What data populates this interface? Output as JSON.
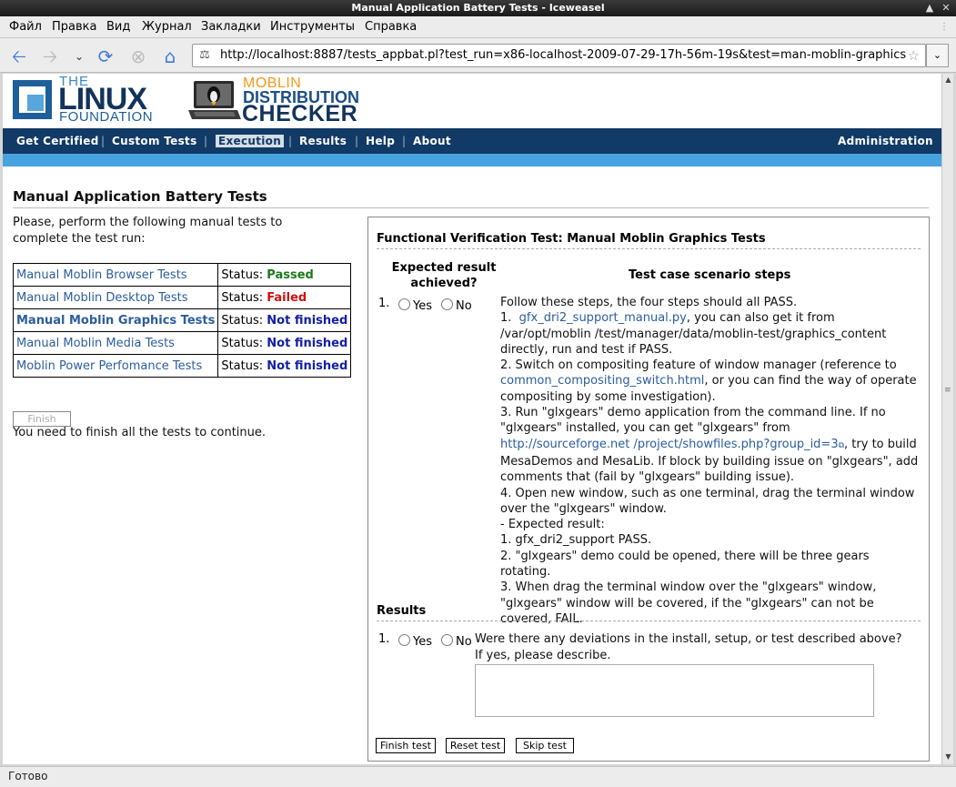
{
  "window": {
    "title": "Manual Application Battery Tests - Iceweasel",
    "controls": [
      "up-arrow",
      "close"
    ]
  },
  "menubar": [
    "Файл",
    "Правка",
    "Вид",
    "Журнал",
    "Закладки",
    "Инструменты",
    "Справка"
  ],
  "toolbar": {
    "url": "http://localhost:8887/tests_appbat.pl?test_run=x86-localhost-2009-07-29-17h-56m-19s&test=man-moblin-graphics",
    "buttons": [
      "back-icon",
      "forward-icon",
      "history-dropdown-icon",
      "reload-icon",
      "stop-icon",
      "home-icon"
    ],
    "accent": "#3f7ad6"
  },
  "header": {
    "lf_the": "THE",
    "lf_linux": "LINUX",
    "lf_foundation": "FOUNDATION",
    "mdc_moblin": "MOBLIN",
    "mdc_distribution": "DISTRIBUTION",
    "mdc_checker": "CHECKER"
  },
  "nav": {
    "get_certified": "Get Certified",
    "custom_tests": "Custom Tests",
    "execution": "Execution",
    "results": "Results",
    "help": "Help",
    "about": "About",
    "administration": "Administration",
    "sep": "|",
    "bg": "#113a66",
    "bar": "#48a4e0"
  },
  "page": {
    "title": "Manual Application Battery Tests",
    "intro": "Please, perform the following manual tests to complete the test run:",
    "tests": [
      {
        "name": "Manual Moblin Browser Tests",
        "status_label": "Status:",
        "status": "Passed"
      },
      {
        "name": "Manual Moblin Desktop Tests",
        "status_label": "Status:",
        "status": "Failed"
      },
      {
        "name": "Manual Moblin Graphics Tests",
        "status_label": "Status:",
        "status": "Not finished"
      },
      {
        "name": "Manual Moblin Media Tests",
        "status_label": "Status:",
        "status": "Not finished"
      },
      {
        "name": "Moblin Power Perfomance Tests",
        "status_label": "Status:",
        "status": "Not finished"
      }
    ],
    "finish_button": "Finish",
    "finish_note": "You need to finish all the tests to continue."
  },
  "panel": {
    "title": "Functional Verification Test: Manual Moblin Graphics Tests",
    "col_expected": "Expected result achieved?",
    "col_steps": "Test case scenario steps",
    "step_number": "1.",
    "yes": "Yes",
    "no": "No",
    "steps": {
      "intro": "Follow these steps, the four steps should all PASS.",
      "s1_num": "1.",
      "s1_link": "gfx_dri2_support_manual.py",
      "s1_text": ", you can also get it from /var/opt/moblin /test/manager/data/moblin-test/graphics_content directly, run and test if PASS.",
      "s2_text": "2. Switch on compositing feature of window manager (reference to",
      "s2_link": "common_compositing_switch.html",
      "s2_text2": ", or you can find the way of operate compositing by some investigation).",
      "s3_text": "3. Run \"glxgears\" demo application from the command line. If no \"glxgears\" installed, you can get \"glxgears\" from",
      "s3_link": "http://sourceforge.net /project/showfiles.php?group_id=3",
      "s3_text2": ", try to build MesaDemos and MesaLib. If block by building issue on \"glxgears\", add comments that (fail by \"glxgears\" building issue).",
      "s4_text": "4. Open new window, such as one terminal, drag the terminal window over the \"glxgears\" window.",
      "expected_title": "- Expected result:",
      "e1": "1. gfx_dri2_support PASS.",
      "e2": "2. \"glxgears\" demo could be opened, there will be three gears rotating.",
      "e3": "3. When drag the terminal window over the \"glxgears\" window, \"glxgears\" window will be covered, if the \"glxgears\" can not be covered, FAIL."
    },
    "results_title": "Results",
    "question": "Were there any deviations in the install, setup, or test described above?",
    "question2": "If yes, please describe.",
    "finish_test": "Finish test",
    "reset_test": "Reset test",
    "skip_test": "Skip test"
  },
  "status_bar": "Готово"
}
